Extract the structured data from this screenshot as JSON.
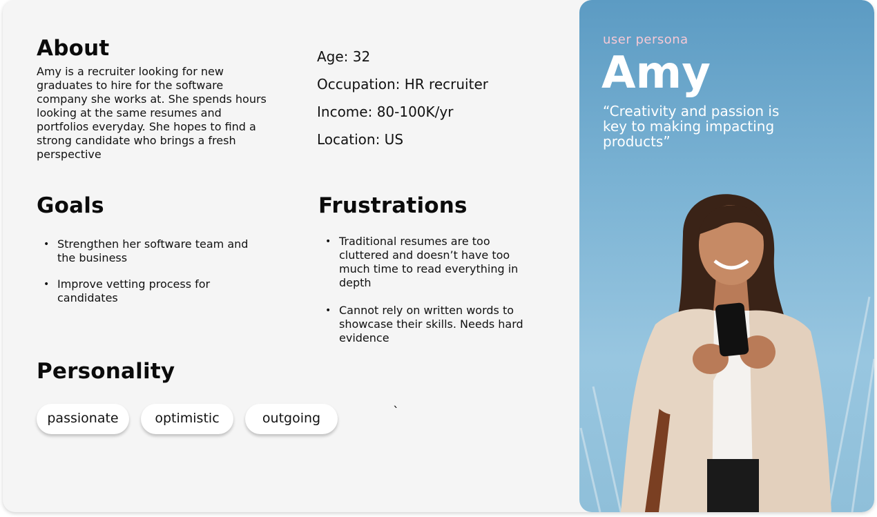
{
  "about": {
    "heading": "About",
    "text": "Amy is a recruiter looking for new graduates to hire for the software company she works at. She spends hours looking at the same resumes and portfolios everyday. She hopes to find a strong candidate who brings a fresh perspective"
  },
  "stats": {
    "age": "Age: 32",
    "occupation": "Occupation: HR recruiter",
    "income": "Income: 80-100K/yr",
    "location": "Location: US"
  },
  "goals": {
    "heading": "Goals",
    "items": [
      "Strengthen her software team and the business",
      "Improve vetting process for candidates"
    ]
  },
  "frustrations": {
    "heading": "Frustrations",
    "items": [
      "Traditional resumes are too cluttered and doesn’t have too much time to read everything in depth",
      "Cannot rely on written words to showcase their skills. Needs hard evidence"
    ]
  },
  "personality": {
    "heading": "Personality",
    "traits": [
      "passionate",
      "optimistic",
      "outgoing"
    ],
    "stray_mark": "`"
  },
  "persona": {
    "label": "user persona",
    "name": "Amy",
    "quote": "“Creativity and passion is key to making impacting products”",
    "photo_icon": "woman-with-phone-photo"
  },
  "colors": {
    "card_bg": "#f5f5f5",
    "panel_sky": "#7ab2d3",
    "label_pink": "#f6c9d6"
  }
}
